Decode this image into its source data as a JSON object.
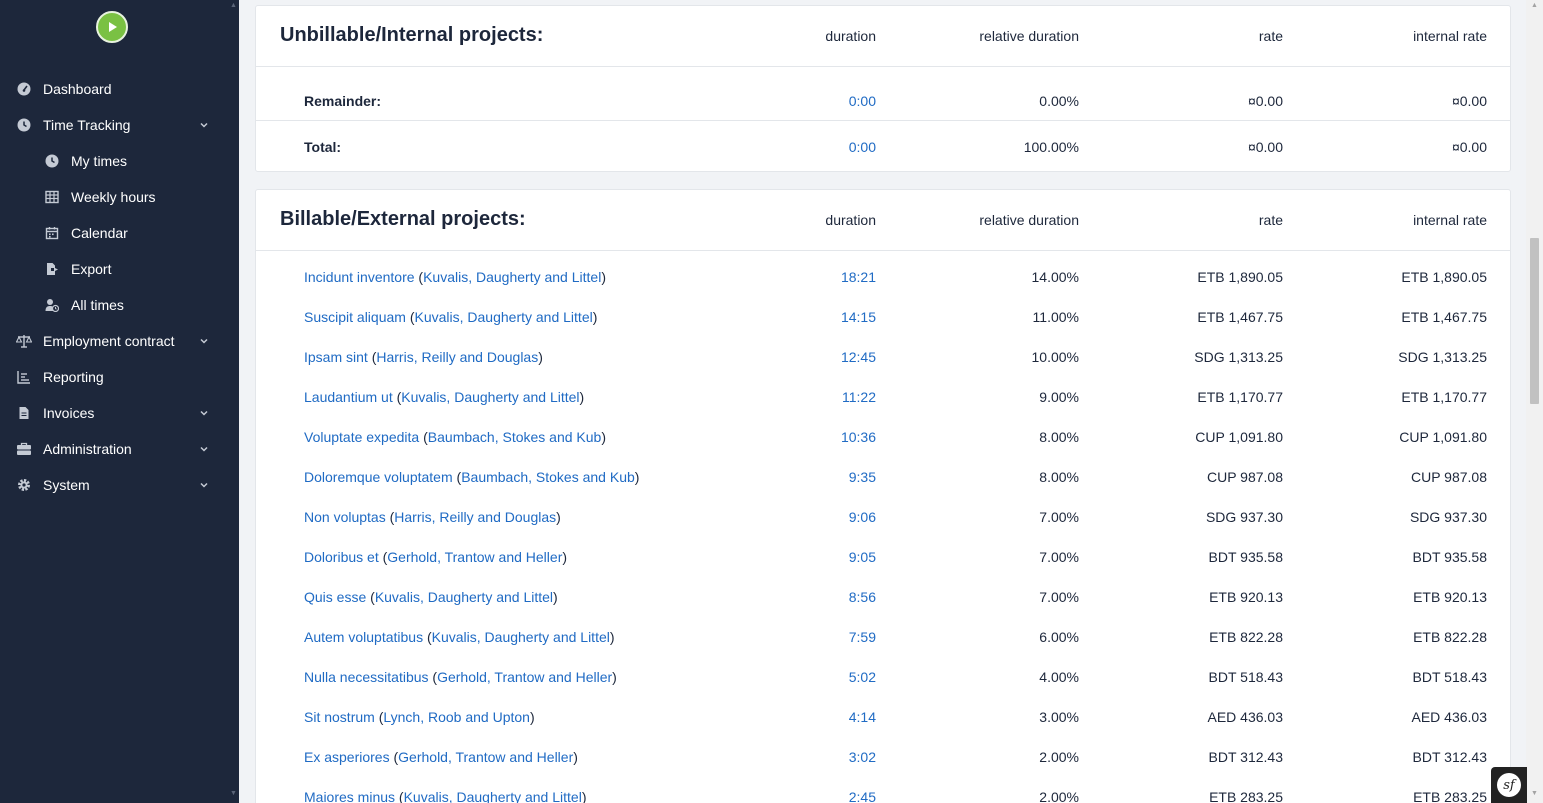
{
  "sidebar": {
    "items": [
      {
        "label": "Dashboard",
        "icon": "dashboard-icon"
      },
      {
        "label": "Time Tracking",
        "icon": "clock-icon",
        "expandable": true
      },
      {
        "label": "My times",
        "icon": "clock-icon",
        "sub": true
      },
      {
        "label": "Weekly hours",
        "icon": "table-icon",
        "sub": true
      },
      {
        "label": "Calendar",
        "icon": "calendar-icon",
        "sub": true
      },
      {
        "label": "Export",
        "icon": "export-icon",
        "sub": true
      },
      {
        "label": "All times",
        "icon": "user-clock-icon",
        "sub": true
      },
      {
        "label": "Employment contract",
        "icon": "scale-icon",
        "expandable": true
      },
      {
        "label": "Reporting",
        "icon": "chart-icon"
      },
      {
        "label": "Invoices",
        "icon": "file-invoice-icon",
        "expandable": true
      },
      {
        "label": "Administration",
        "icon": "toolbox-icon",
        "expandable": true
      },
      {
        "label": "System",
        "icon": "gear-icon",
        "expandable": true
      }
    ]
  },
  "columns": {
    "duration": "duration",
    "relative": "relative duration",
    "rate": "rate",
    "internal": "internal rate"
  },
  "unbillable": {
    "title": "Unbillable/Internal projects:",
    "remainder": {
      "label": "Remainder:",
      "duration": "0:00",
      "relative": "0.00%",
      "rate": "¤0.00",
      "internal": "¤0.00"
    },
    "total": {
      "label": "Total:",
      "duration": "0:00",
      "relative": "100.00%",
      "rate": "¤0.00",
      "internal": "¤0.00"
    }
  },
  "billable": {
    "title": "Billable/External projects:",
    "rows": [
      {
        "project": "Incidunt inventore",
        "customer": "Kuvalis, Daugherty and Littel",
        "duration": "18:21",
        "relative": "14.00%",
        "rate": "ETB 1,890.05",
        "internal": "ETB 1,890.05"
      },
      {
        "project": "Suscipit aliquam",
        "customer": "Kuvalis, Daugherty and Littel",
        "duration": "14:15",
        "relative": "11.00%",
        "rate": "ETB 1,467.75",
        "internal": "ETB 1,467.75"
      },
      {
        "project": "Ipsam sint",
        "customer": "Harris, Reilly and Douglas",
        "duration": "12:45",
        "relative": "10.00%",
        "rate": "SDG 1,313.25",
        "internal": "SDG 1,313.25"
      },
      {
        "project": "Laudantium ut",
        "customer": "Kuvalis, Daugherty and Littel",
        "duration": "11:22",
        "relative": "9.00%",
        "rate": "ETB 1,170.77",
        "internal": "ETB 1,170.77"
      },
      {
        "project": "Voluptate expedita",
        "customer": "Baumbach, Stokes and Kub",
        "duration": "10:36",
        "relative": "8.00%",
        "rate": "CUP 1,091.80",
        "internal": "CUP 1,091.80"
      },
      {
        "project": "Doloremque voluptatem",
        "customer": "Baumbach, Stokes and Kub",
        "duration": "9:35",
        "relative": "8.00%",
        "rate": "CUP 987.08",
        "internal": "CUP 987.08"
      },
      {
        "project": "Non voluptas",
        "customer": "Harris, Reilly and Douglas",
        "duration": "9:06",
        "relative": "7.00%",
        "rate": "SDG 937.30",
        "internal": "SDG 937.30"
      },
      {
        "project": "Doloribus et",
        "customer": "Gerhold, Trantow and Heller",
        "duration": "9:05",
        "relative": "7.00%",
        "rate": "BDT 935.58",
        "internal": "BDT 935.58"
      },
      {
        "project": "Quis esse",
        "customer": "Kuvalis, Daugherty and Littel",
        "duration": "8:56",
        "relative": "7.00%",
        "rate": "ETB 920.13",
        "internal": "ETB 920.13"
      },
      {
        "project": "Autem voluptatibus",
        "customer": "Kuvalis, Daugherty and Littel",
        "duration": "7:59",
        "relative": "6.00%",
        "rate": "ETB 822.28",
        "internal": "ETB 822.28"
      },
      {
        "project": "Nulla necessitatibus",
        "customer": "Gerhold, Trantow and Heller",
        "duration": "5:02",
        "relative": "4.00%",
        "rate": "BDT 518.43",
        "internal": "BDT 518.43"
      },
      {
        "project": "Sit nostrum",
        "customer": "Lynch, Roob and Upton",
        "duration": "4:14",
        "relative": "3.00%",
        "rate": "AED 436.03",
        "internal": "AED 436.03"
      },
      {
        "project": "Ex asperiores",
        "customer": "Gerhold, Trantow and Heller",
        "duration": "3:02",
        "relative": "2.00%",
        "rate": "BDT 312.43",
        "internal": "BDT 312.43"
      },
      {
        "project": "Maiores minus",
        "customer": "Kuvalis, Daugherty and Littel",
        "duration": "2:45",
        "relative": "2.00%",
        "rate": "ETB 283.25",
        "internal": "ETB 283.25"
      }
    ]
  },
  "symfony": {
    "glyph": "sf"
  },
  "colors": {
    "sidebar_bg": "#1d273b",
    "link": "#206bc4",
    "logo": "#7ac143"
  }
}
